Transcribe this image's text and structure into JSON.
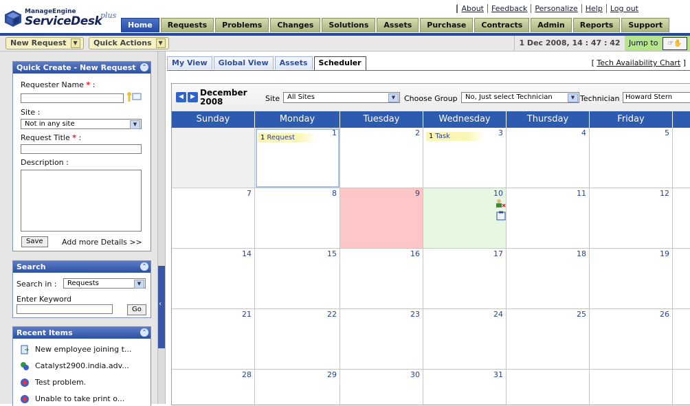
{
  "header": {
    "brand_top": "ManageEngine",
    "brand_main": "ServiceDesk",
    "brand_plus": "plus",
    "links": [
      "About",
      "Feedback",
      "Personalize",
      "Help",
      "Log out"
    ],
    "tabs": [
      "Home",
      "Requests",
      "Problems",
      "Changes",
      "Solutions",
      "Assets",
      "Purchase",
      "Contracts",
      "Admin",
      "Reports",
      "Support"
    ],
    "active_tab": "Home"
  },
  "toolbar": {
    "new_request": "New Request",
    "quick_actions": "Quick Actions",
    "datetime": "1 Dec 2008, 14 : 47 : 42",
    "jump_to": "Jump to"
  },
  "quick_create": {
    "title": "Quick Create - New Request",
    "requester_label": "Requester Name",
    "required_mark": "*",
    "colon": ":",
    "site_label": "Site :",
    "site_value": "Not in any site",
    "request_title_label": "Request Title",
    "description_label": "Description :",
    "save": "Save",
    "add_more": "Add more Details >>"
  },
  "search": {
    "title": "Search",
    "search_in_label": "Search in :",
    "search_in_value": "Requests",
    "keyword_label": "Enter Keyword",
    "go": "Go"
  },
  "recent": {
    "title": "Recent Items",
    "items": [
      "New employee joining t...",
      "Catalyst2900.india.adv...",
      "Test problem.",
      "Unable to take print o..."
    ]
  },
  "view_tabs": [
    "My View",
    "Global View",
    "Assets",
    "Scheduler"
  ],
  "active_view": "Scheduler",
  "tech_chart": {
    "open": "[",
    "label": "Tech Availability Chart",
    "close": "]"
  },
  "calendar": {
    "month_line1": "December",
    "month_line2": "2008",
    "site_label": "Site",
    "site_value": "All Sites",
    "group_label": "Choose Group",
    "group_value": "No, Just select Technician",
    "tech_label": "Technician",
    "tech_value": "Howard Stern",
    "days": [
      "Sunday",
      "Monday",
      "Tuesday",
      "Wednesday",
      "Thursday",
      "Friday"
    ],
    "weeks": [
      [
        "",
        "1",
        "2",
        "3",
        "4",
        "5"
      ],
      [
        "7",
        "8",
        "9",
        "10",
        "11",
        "12"
      ],
      [
        "14",
        "15",
        "16",
        "17",
        "18",
        "19"
      ],
      [
        "21",
        "22",
        "23",
        "24",
        "25",
        "26"
      ],
      [
        "28",
        "29",
        "30",
        "31",
        "",
        ""
      ]
    ],
    "events": {
      "mon1_count": "1",
      "mon1_label": "Request",
      "wed3_count": "1",
      "wed3_label": "Task"
    }
  }
}
